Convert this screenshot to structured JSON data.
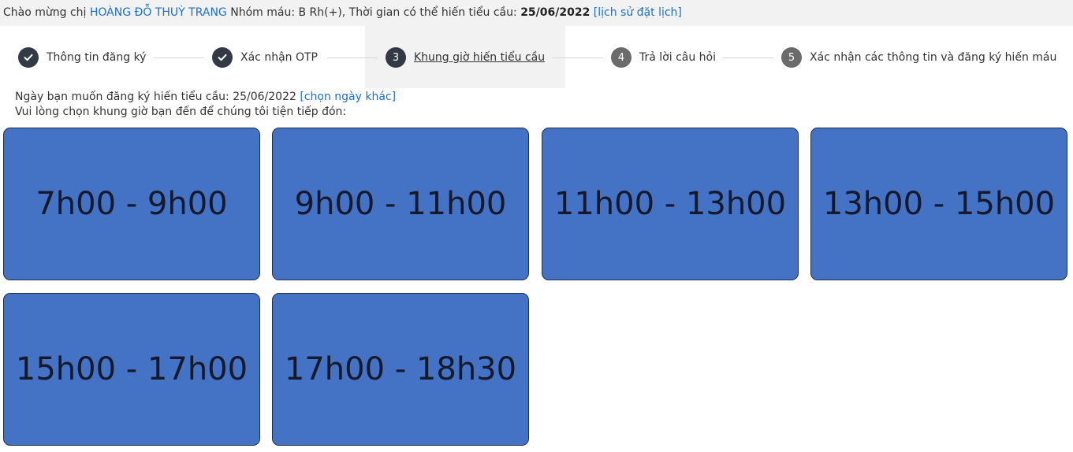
{
  "topbar": {
    "greeting": "Chào mừng chị ",
    "user_name": "HOÀNG ĐỖ THUỲ TRANG",
    "blood_group_text": " Nhóm máu: B Rh(+), Thời gian có thể hiến tiểu cầu: ",
    "date": "25/06/2022",
    "history_link": "[lịch sử đặt lịch]"
  },
  "steps": [
    {
      "marker": "check",
      "label": "Thông tin đăng ký"
    },
    {
      "marker": "check",
      "label": "Xác nhận OTP"
    },
    {
      "marker": "3",
      "label": "Khung giờ hiến tiểu cầu"
    },
    {
      "marker": "4",
      "label": "Trả lời câu hỏi"
    },
    {
      "marker": "5",
      "label": "Xác nhận các thông tin và đăng ký hiến máu"
    }
  ],
  "info": {
    "line1_text": "Ngày bạn muốn đăng ký hiến tiểu cầu: 25/06/2022 ",
    "change_date_link": "[chọn ngày khác]",
    "line2_text": "Vui lòng chọn khung giờ bạn đến để chúng tôi tiện tiếp đón:"
  },
  "time_slots": [
    "7h00 - 9h00",
    "9h00 - 11h00",
    "11h00 - 13h00",
    "13h00 - 15h00",
    "15h00 - 17h00",
    "17h00 - 18h30"
  ],
  "colors": {
    "accent": "#1f6fc6",
    "slot_fill": "#4472c4",
    "step_dark": "#333a45",
    "step_grey": "#6b6b6b"
  }
}
